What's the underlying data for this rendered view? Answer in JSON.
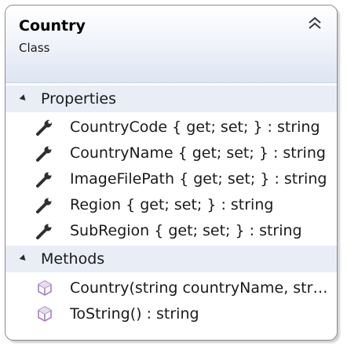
{
  "class_box": {
    "name": "Country",
    "kind": "Class",
    "collapse_icon": "double-chevron-up-icon"
  },
  "sections": {
    "properties": {
      "label": "Properties",
      "icon": "wrench-icon",
      "items": [
        "CountryCode { get; set; } : string",
        "CountryName { get; set; } : string",
        "ImageFilePath { get; set; } : string",
        "Region { get; set; } : string",
        "SubRegion { get; set; } : string"
      ]
    },
    "methods": {
      "label": "Methods",
      "icon": "method-cube-icon",
      "items": [
        "Country(string countryName, stri...",
        "ToString() : string"
      ]
    }
  },
  "colors": {
    "method_icon": "#a57fc0",
    "header_gradient_end": "#dde5f1",
    "section_header_bg": "#e8edf6"
  }
}
